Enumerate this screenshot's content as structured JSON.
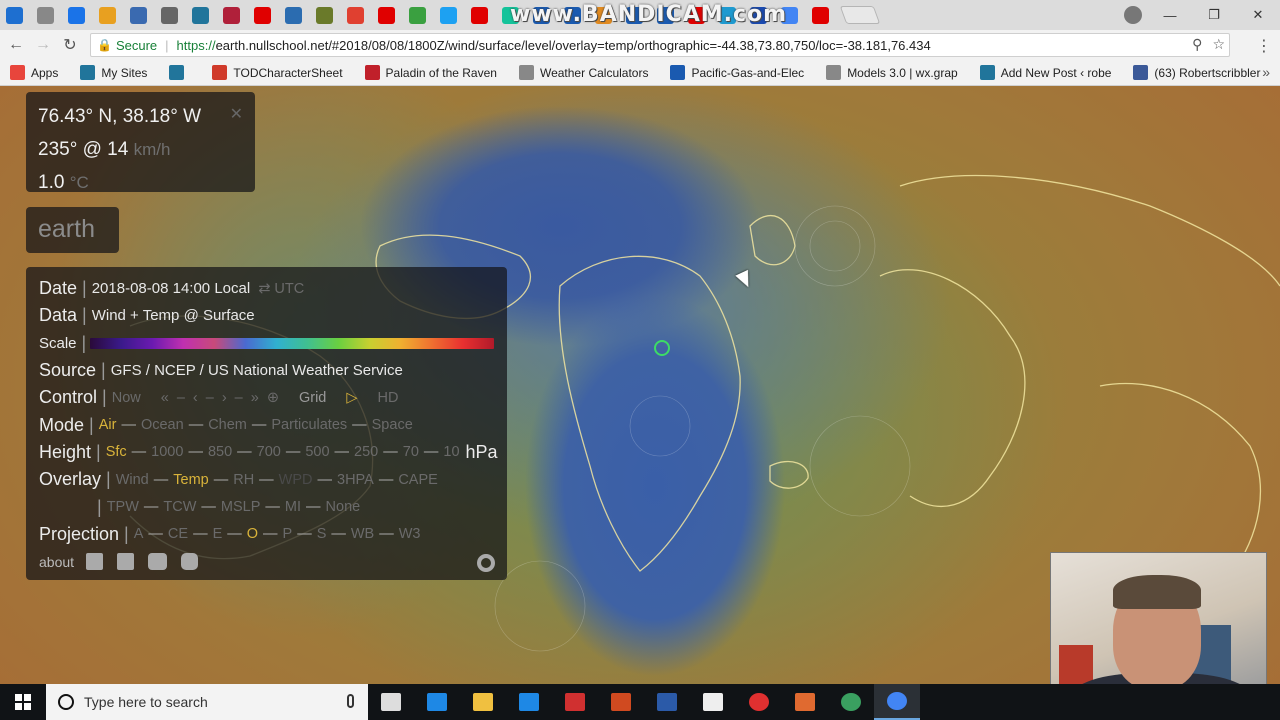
{
  "browser": {
    "bandicam_watermark": "www.BANDICAM.com",
    "tabs": [
      {
        "icon": "edge-icon",
        "color": "#1e6fd0"
      },
      {
        "icon": "page-icon",
        "color": "#888888"
      },
      {
        "icon": "calendar-icon",
        "color": "#1a73e8"
      },
      {
        "icon": "map-icon",
        "color": "#e8a020"
      },
      {
        "icon": "globe-icon",
        "color": "#3a6ab0"
      },
      {
        "icon": "wikipedia-icon",
        "color": "#666666"
      },
      {
        "icon": "wordpress-icon",
        "color": "#21759b"
      },
      {
        "icon": "dictionary-icon",
        "color": "#b0203a"
      },
      {
        "icon": "youtube-icon",
        "color": "#e00000"
      },
      {
        "icon": "cr-icon",
        "color": "#2b6cb0"
      },
      {
        "icon": "square-icon",
        "color": "#6a7a2a"
      },
      {
        "icon": "tumblr-icon",
        "color": "#e04030"
      },
      {
        "icon": "youtube-icon",
        "color": "#e00000"
      },
      {
        "icon": "map-icon",
        "color": "#3aa040"
      },
      {
        "icon": "twitter-icon",
        "color": "#1da1f2"
      },
      {
        "icon": "youtube-icon",
        "color": "#e00000"
      },
      {
        "icon": "grammarly-icon",
        "color": "#15c39a"
      },
      {
        "icon": "snowflake-icon",
        "color": "#1a5ab0"
      },
      {
        "icon": "snowflake-icon",
        "color": "#1a5ab0"
      },
      {
        "icon": "weather-icon",
        "color": "#e08a20"
      },
      {
        "icon": "noaa-icon",
        "color": "#1a5ab0"
      },
      {
        "icon": "noaa-icon",
        "color": "#1a5ab0"
      },
      {
        "icon": "youtube-icon",
        "color": "#e00000"
      },
      {
        "icon": "edge-icon",
        "color": "#1e9ad0"
      },
      {
        "icon": "circle-icon",
        "color": "#1a4ab0"
      },
      {
        "icon": "google-icon",
        "color": "#4285f4"
      },
      {
        "icon": "youtube-icon",
        "color": "#e00000"
      }
    ],
    "address": {
      "secure_label": "Secure",
      "url_scheme": "https://",
      "url_rest": "earth.nullschool.net/#2018/08/08/1800Z/wind/surface/level/overlay=temp/orthographic=-44.38,73.80,750/loc=-38.181,76.434"
    },
    "bookmarks": [
      {
        "label": "Apps",
        "icon": "apps-icon",
        "color": "#e8453c"
      },
      {
        "label": "My Sites",
        "icon": "wordpress-icon",
        "color": "#21759b"
      },
      {
        "label": "",
        "icon": "wordpress-icon",
        "color": "#21759b"
      },
      {
        "label": "TODCharacterSheet",
        "icon": "pdf-icon",
        "color": "#d03a2a"
      },
      {
        "label": "Paladin of the Raven",
        "icon": "paladin-icon",
        "color": "#c0202a"
      },
      {
        "label": "Weather Calculators",
        "icon": "weather-icon",
        "color": "#888888"
      },
      {
        "label": "Pacific-Gas-and-Elec",
        "icon": "pge-icon",
        "color": "#1a5ab0"
      },
      {
        "label": "Models 3.0 | wx.grap",
        "icon": "page-icon",
        "color": "#888888"
      },
      {
        "label": "Add New Post ‹ robe",
        "icon": "wordpress-icon",
        "color": "#21759b"
      },
      {
        "label": "(63) Robertscribbler",
        "icon": "facebook-icon",
        "color": "#3b5998"
      }
    ]
  },
  "spot": {
    "coords": "76.43° N, 38.18° W",
    "wind": "235° @ 14",
    "wind_unit": "km/h",
    "temp": "1.0",
    "temp_unit": "°C",
    "close": "✕"
  },
  "earth_button": "earth",
  "menu": {
    "date_label": "Date",
    "date_value": "2018-08-08 14:00 Local",
    "date_toggle": "⇄ UTC",
    "data_label": "Data",
    "data_value": "Wind + Temp @ Surface",
    "scale_label": "Scale",
    "source_label": "Source",
    "source_value": "GFS / NCEP / US National Weather Service",
    "control_label": "Control",
    "control_items": [
      "Now",
      "«",
      "–",
      "‹",
      "–",
      "›",
      "–",
      "»",
      "⊕",
      "Grid",
      "▷",
      "HD"
    ],
    "mode_label": "Mode",
    "mode_items": [
      "Air",
      "Ocean",
      "Chem",
      "Particulates",
      "Space"
    ],
    "height_label": "Height",
    "height_items": [
      "Sfc",
      "1000",
      "850",
      "700",
      "500",
      "250",
      "70",
      "10"
    ],
    "height_unit": "hPa",
    "overlay_label": "Overlay",
    "overlay_items_1": [
      "Wind",
      "Temp",
      "RH",
      "WPD",
      "3HPA",
      "CAPE"
    ],
    "overlay_items_2": [
      "TPW",
      "TCW",
      "MSLP",
      "MI",
      "None"
    ],
    "projection_label": "Projection",
    "projection_items": [
      "A",
      "CE",
      "E",
      "O",
      "P",
      "S",
      "WB",
      "W3"
    ],
    "about": "about"
  },
  "taskbar": {
    "search_placeholder": "Type here to search",
    "apps": [
      {
        "icon": "task-view-icon",
        "color": "#dddddd"
      },
      {
        "icon": "edge-icon",
        "color": "#1e88e5"
      },
      {
        "icon": "file-explorer-icon",
        "color": "#f0c040"
      },
      {
        "icon": "store-icon",
        "color": "#1e88e5"
      },
      {
        "icon": "acrobat-icon",
        "color": "#d03030"
      },
      {
        "icon": "powerpoint-icon",
        "color": "#d04a20"
      },
      {
        "icon": "word-icon",
        "color": "#2b5aa8"
      },
      {
        "icon": "mail-icon",
        "color": "#eeeeee"
      },
      {
        "icon": "record-icon",
        "color": "#e03030"
      },
      {
        "icon": "paint-icon",
        "color": "#e06a30"
      },
      {
        "icon": "settings-icon",
        "color": "#3aa060"
      },
      {
        "icon": "chrome-icon",
        "color": "#4285f4"
      }
    ]
  }
}
